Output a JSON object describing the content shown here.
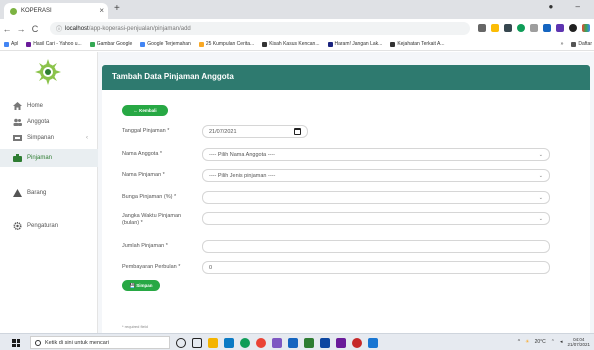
{
  "browser": {
    "tab_title": "KOPERASI",
    "tab_close": "×",
    "new_tab": "+",
    "address": {
      "host": "localhost",
      "path": "/app-koperasi-penjualan/pinjaman/add"
    },
    "bookmarks": [
      {
        "label": "Apl",
        "color": "#4285f4"
      },
      {
        "label": "Hasil Cari - Yahoo u...",
        "color": "#6a1b9a"
      },
      {
        "label": "Gambar Google",
        "color": "#34a853"
      },
      {
        "label": "Google Terjemahan",
        "color": "#4285f4"
      },
      {
        "label": "25 Kumpulan Cerita...",
        "color": "#f9a825"
      },
      {
        "label": "Kisah Kasus Kencan...",
        "color": "#333333"
      },
      {
        "label": "Haram! Jangan Lak...",
        "color": "#1a237e"
      },
      {
        "label": "Kejahatan Terkait A...",
        "color": "#333333"
      }
    ],
    "bookmarks_more": "»",
    "bookmarks_other": "Daftar"
  },
  "sidebar": {
    "items": [
      {
        "label": "Home",
        "icon": "home-icon"
      },
      {
        "label": "Anggota",
        "icon": "users-icon"
      },
      {
        "label": "Simpanan",
        "icon": "savings-icon",
        "chevron": "‹"
      },
      {
        "label": "Pinjaman",
        "icon": "loan-icon"
      },
      {
        "label": "Barang",
        "icon": "box-icon"
      },
      {
        "label": "Pengaturan",
        "icon": "gear-icon"
      }
    ]
  },
  "page": {
    "title": "Tambah Data Pinjaman Anggota",
    "back_button": "← Kembali",
    "save_button": "💾 Simpan",
    "required_note": "* required field",
    "accent_color": "#2e7a6f",
    "button_color": "#27a844"
  },
  "form": {
    "tanggal": {
      "label": "Tanggal Pinjaman *",
      "value": "21/07/2021"
    },
    "anggota": {
      "label": "Nama Anggota *",
      "value": "---- Pilih Nama Anggota ----"
    },
    "jenis": {
      "label": "Nama Pinjaman *",
      "value": "---- Pilih Jenis pinjaman ----"
    },
    "bunga": {
      "label": "Bunga Pinjaman (%) *",
      "value": ""
    },
    "jangka": {
      "label": "Jangka Waktu Pinjaman (bulan) *",
      "value": ""
    },
    "jumlah": {
      "label": "Jumlah Pinjaman *",
      "value": ""
    },
    "bulanan": {
      "label": "Pembayaran Perbulan *",
      "value": "0"
    }
  },
  "taskbar": {
    "search_placeholder": "Ketik di sini untuk mencari",
    "temperature": "20°C",
    "time": "04:04",
    "date": "21/07/2021"
  }
}
